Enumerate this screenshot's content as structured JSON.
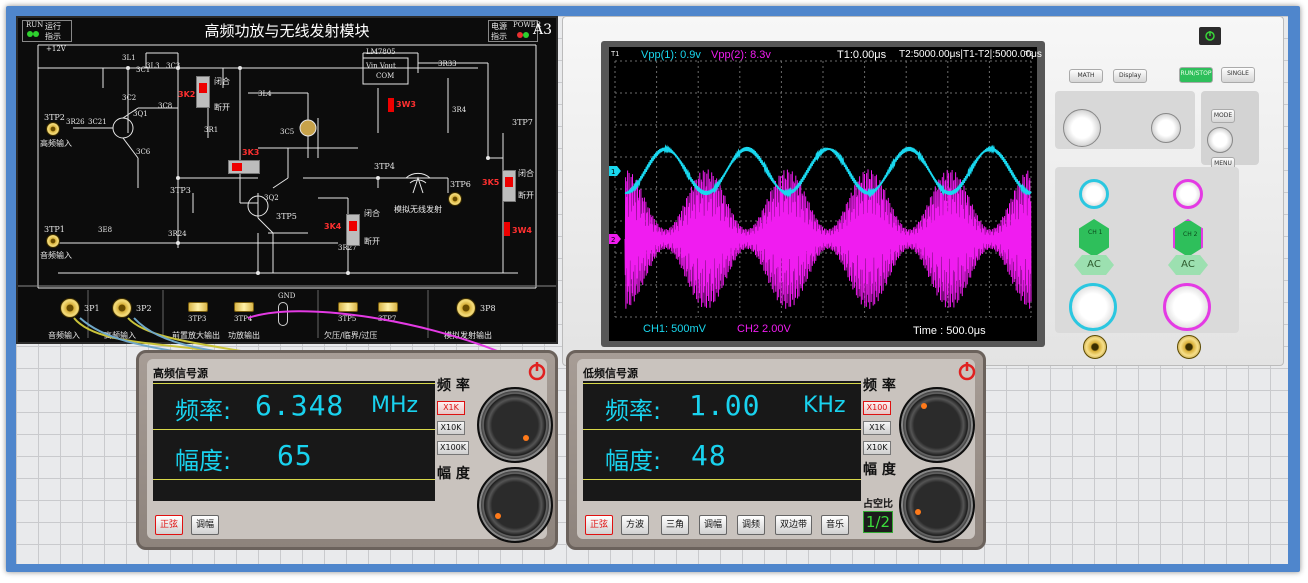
{
  "board": {
    "title": "高频功放与无线发射模块",
    "run_label_top": "RUN",
    "run_label": "运行",
    "run_label2": "指示",
    "power_label": "电源",
    "power_label_top": "POWER",
    "power_label2": "指示",
    "module_id": "A3",
    "supply": "+12V",
    "regulator": "LM7805",
    "regulator_pins": "Vin  Vout",
    "regulator_com": "COM",
    "components": [
      "3L1",
      "3C1",
      "3C2",
      "3C3",
      "3L3",
      "3L4",
      "3C5",
      "3Q1",
      "3C8",
      "3C6",
      "3R1",
      "3R2",
      "3R3",
      "3R4",
      "3R7",
      "3R8",
      "3R9",
      "3C10",
      "3C11",
      "3C12",
      "3L2",
      "3R33",
      "3Q2",
      "3R24",
      "3R25",
      "3R26",
      "3C21",
      "3C22",
      "3E8",
      "3C7",
      "3R27"
    ],
    "switch_labels": [
      "3K2",
      "3K3",
      "3K4",
      "3K5",
      "3W3",
      "3W4"
    ],
    "text_close": "闭合",
    "text_open": "断开",
    "tp_labels": [
      "3TP1",
      "3TP2",
      "3TP3",
      "3TP4",
      "3TP5",
      "3TP6",
      "3TP7",
      "3TP8"
    ],
    "label_audio_input": "音频输入",
    "label_hf_input": "高频输入",
    "label_antenna": "模拟无线发射",
    "gnd": "GND",
    "bottom_labels": [
      "音频输入",
      "高频输入",
      "前置放大输出",
      "功放输出",
      "欠压/临界/过压",
      "模拟发射输出"
    ],
    "bottom_tps": [
      "3P1",
      "3P2",
      "3TP3",
      "3TP4",
      "3TP5",
      "3TP7",
      "3P8"
    ]
  },
  "scope": {
    "ch1_vpp": "Vpp(1): 0.9v",
    "ch2_vpp": "Vpp(2): 8.3v",
    "t1": "T1:0.00μs",
    "t2": "T2:5000.00μs|T1-T2|:5000.00μs",
    "ch1_scale": "CH1: 500mV",
    "ch2_scale": "CH2    2.00V",
    "timebase": "Time : 500.0μs",
    "marker_t1": "T1",
    "marker_t2": "T2",
    "marker_ch1": "1",
    "marker_ch2": "2",
    "buttons": {
      "math": "MATH",
      "display": "Display",
      "run": "RUN/STOP",
      "single": "SINGLE",
      "mode": "MODE",
      "menu": "MENU"
    },
    "ch_badges": {
      "ch1": "CH 1",
      "ch2": "CH 2",
      "ac1": "AC",
      "ac2": "AC"
    },
    "colors": {
      "ch1": "#19d7ee",
      "ch2": "#f01cf0",
      "accent": "#2ebf5b"
    }
  },
  "gen_hf": {
    "title": "高频信号源",
    "freq_label": "频率:",
    "freq_value": "6.348",
    "freq_unit": "MHz",
    "amp_label": "幅度:",
    "amp_value": "65",
    "side_freq": "频 率",
    "side_amp": "幅 度",
    "multipliers": [
      "X1K",
      "X10K",
      "X100K"
    ],
    "active_multiplier": "X1K",
    "buttons": [
      "正弦",
      "调幅"
    ],
    "active_button": "正弦"
  },
  "gen_lf": {
    "title": "低频信号源",
    "freq_label": "频率:",
    "freq_value": "1.00",
    "freq_unit": "KHz",
    "amp_label": "幅度:",
    "amp_value": "48",
    "side_freq": "频 率",
    "side_amp": "幅 度",
    "duty_label": "占空比",
    "duty_value": "1/2",
    "multipliers": [
      "X100",
      "X1K",
      "X10K"
    ],
    "active_multiplier": "X100",
    "buttons": [
      "正弦",
      "方波",
      "三角",
      "调幅",
      "调频",
      "双边带",
      "音乐"
    ],
    "active_button": "正弦"
  }
}
